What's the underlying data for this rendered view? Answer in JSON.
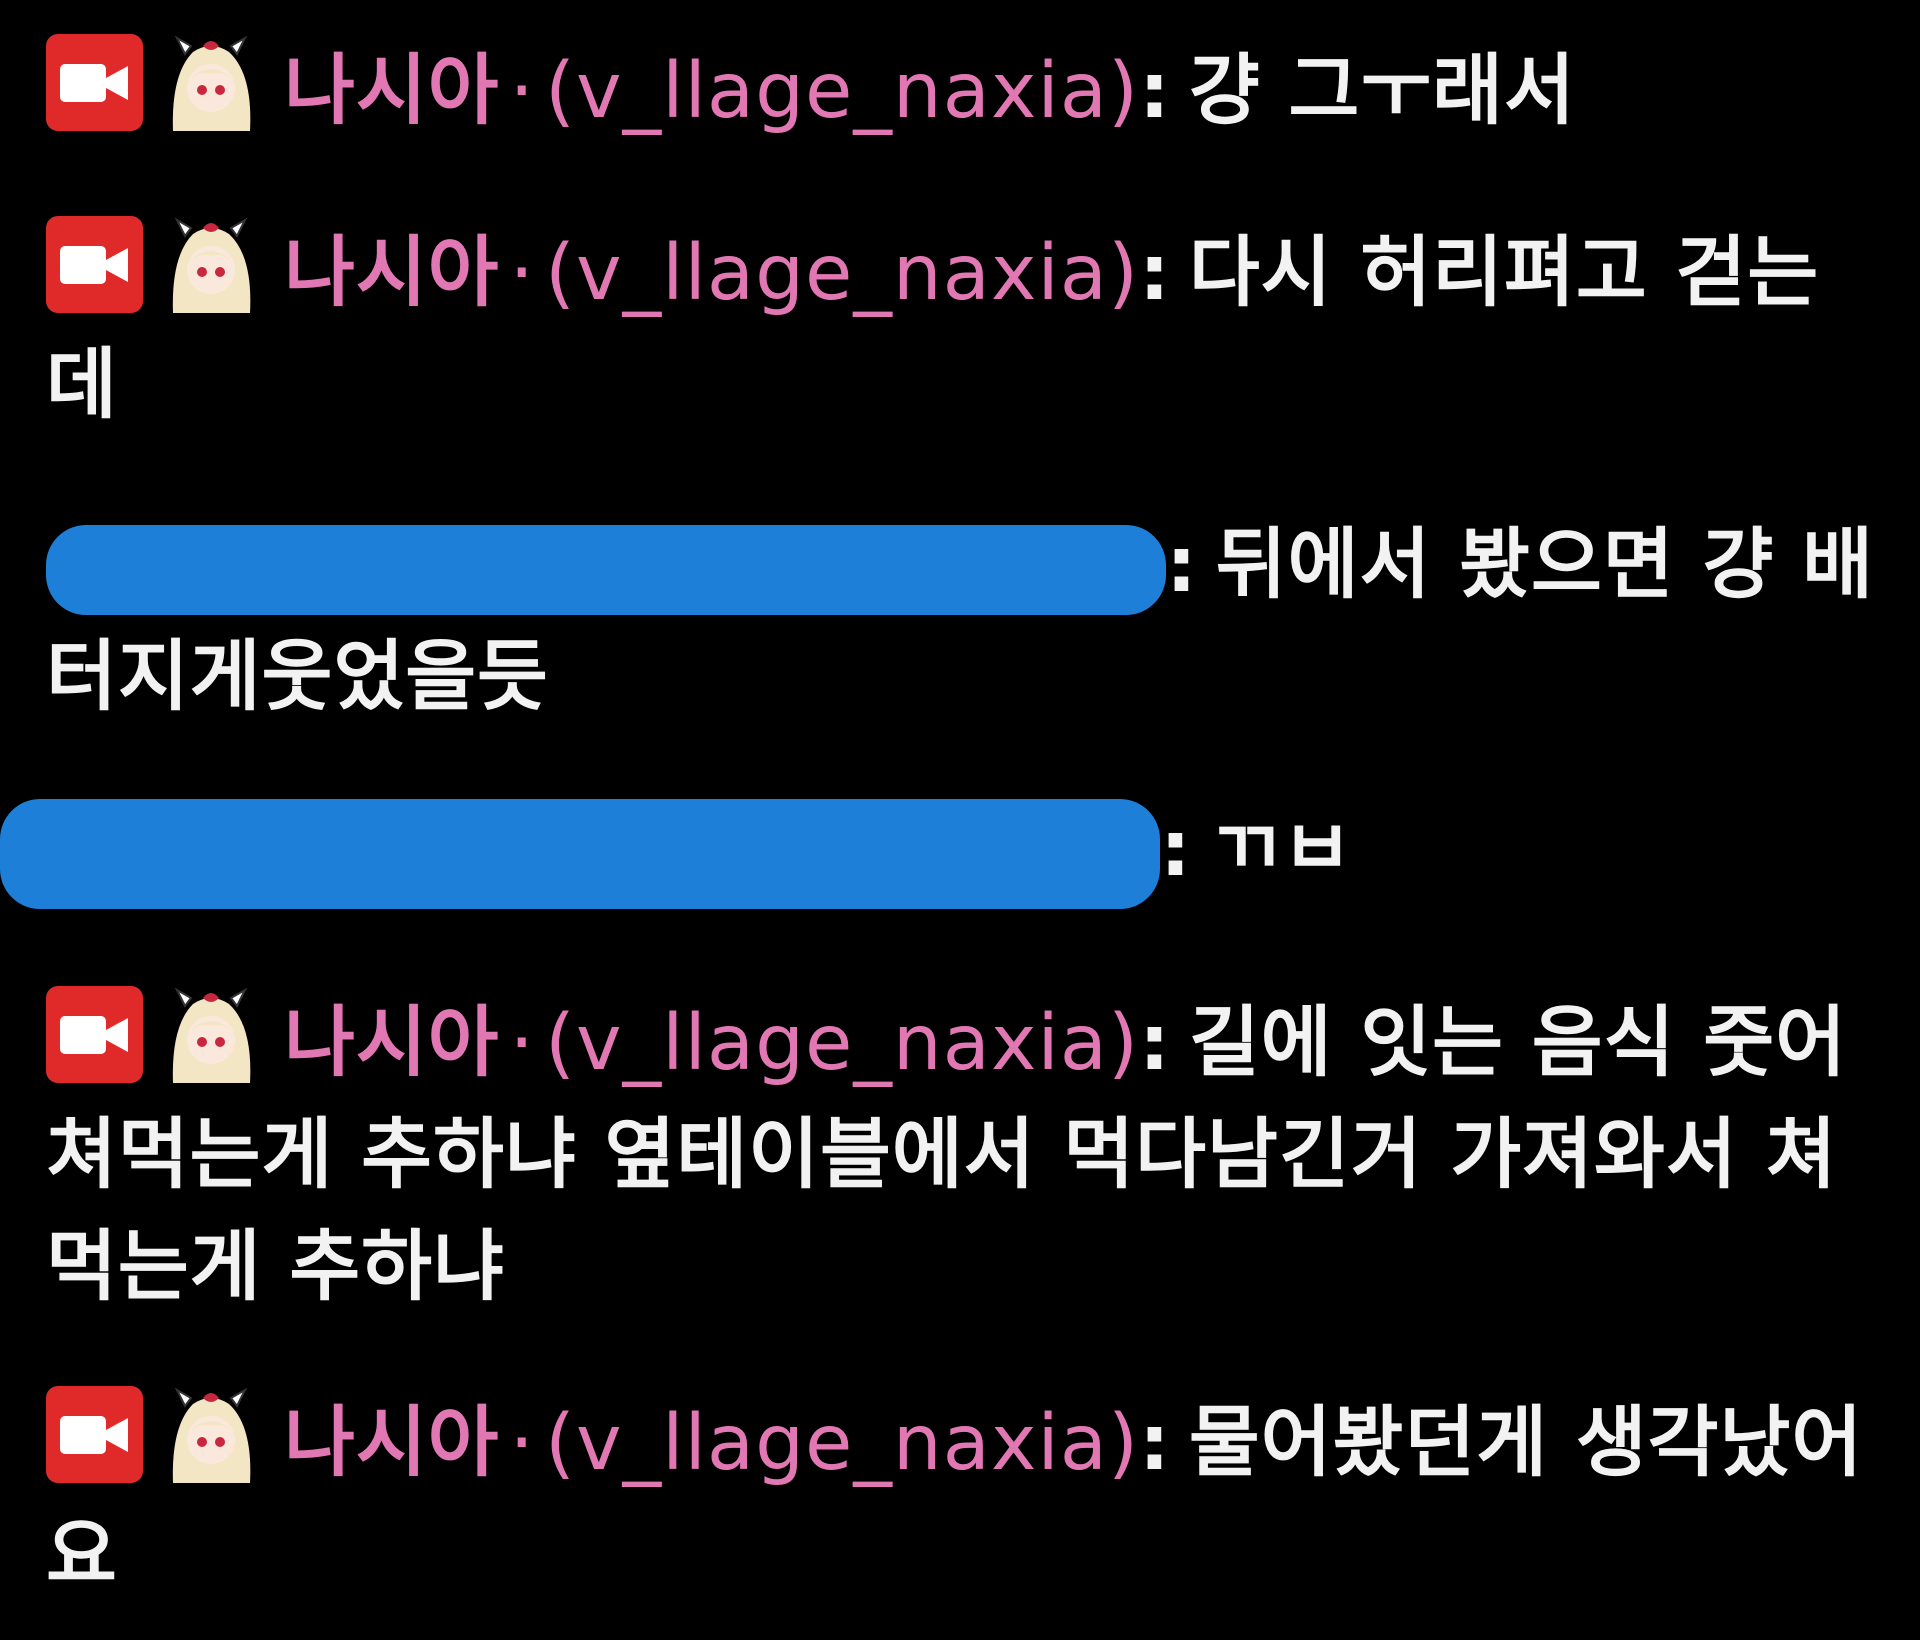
{
  "colors": {
    "background": "#000000",
    "username": "#e178b3",
    "text": "#f2f2f2",
    "badge": "#e02a2a",
    "redaction": "#1e7fd8"
  },
  "messages": [
    {
      "badge_icon": "video-camera-icon",
      "display_name": "나시아",
      "separator": "·",
      "username": "(v_llage_naxia)",
      "colon": ":",
      "text": "걍 그ㅜ래서"
    },
    {
      "badge_icon": "video-camera-icon",
      "display_name": "나시아",
      "separator": "·",
      "username": "(v_llage_naxia)",
      "colon": ":",
      "text": "다시 허리펴고 걷는데"
    },
    {
      "redacted": true,
      "colon": ":",
      "text": "뒤에서 봤으면 걍 배터지게웃었을듯"
    },
    {
      "redacted": true,
      "colon": ":",
      "text": "ㄲㅂ"
    },
    {
      "badge_icon": "video-camera-icon",
      "display_name": "나시아",
      "separator": "·",
      "username": "(v_llage_naxia)",
      "colon": ":",
      "text": "길에 잇는 음식 줏어쳐먹는게 추하냐 옆테이블에서 먹다남긴거 가져와서 쳐먹는게 추하냐"
    },
    {
      "badge_icon": "video-camera-icon",
      "display_name": "나시아",
      "separator": "·",
      "username": "(v_llage_naxia)",
      "colon": ":",
      "text": "물어봤던게 생각났어요"
    }
  ]
}
